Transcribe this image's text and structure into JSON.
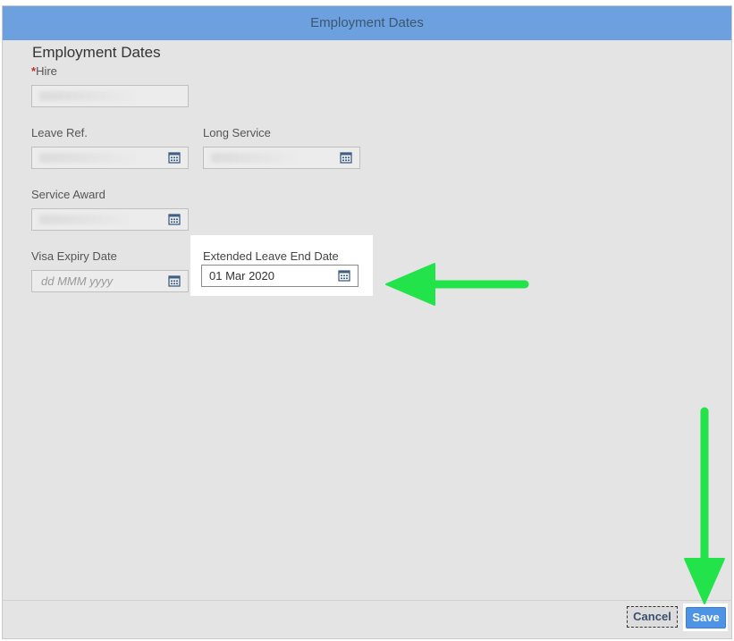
{
  "dialog": {
    "title": "Employment Dates"
  },
  "form": {
    "section_title": "Employment Dates",
    "hire": {
      "label": "Hire",
      "required_mark": "*"
    },
    "leave_ref": {
      "label": "Leave Ref."
    },
    "long_service": {
      "label": "Long Service"
    },
    "service_award": {
      "label": "Service Award"
    },
    "visa_expiry": {
      "label": "Visa Expiry Date",
      "placeholder": "dd MMM yyyy"
    },
    "extended_leave_end": {
      "label": "Extended Leave End Date",
      "value": "01 Mar 2020"
    }
  },
  "footer": {
    "cancel_label": "Cancel",
    "save_label": "Save"
  },
  "colors": {
    "header": "#6ca0de",
    "annotation_arrow": "#22e34a",
    "save_button": "#4d94e6",
    "required_star": "#cc2a2a"
  },
  "icons": {
    "date_picker": "calendar-icon",
    "annotation": "arrow-icon"
  }
}
